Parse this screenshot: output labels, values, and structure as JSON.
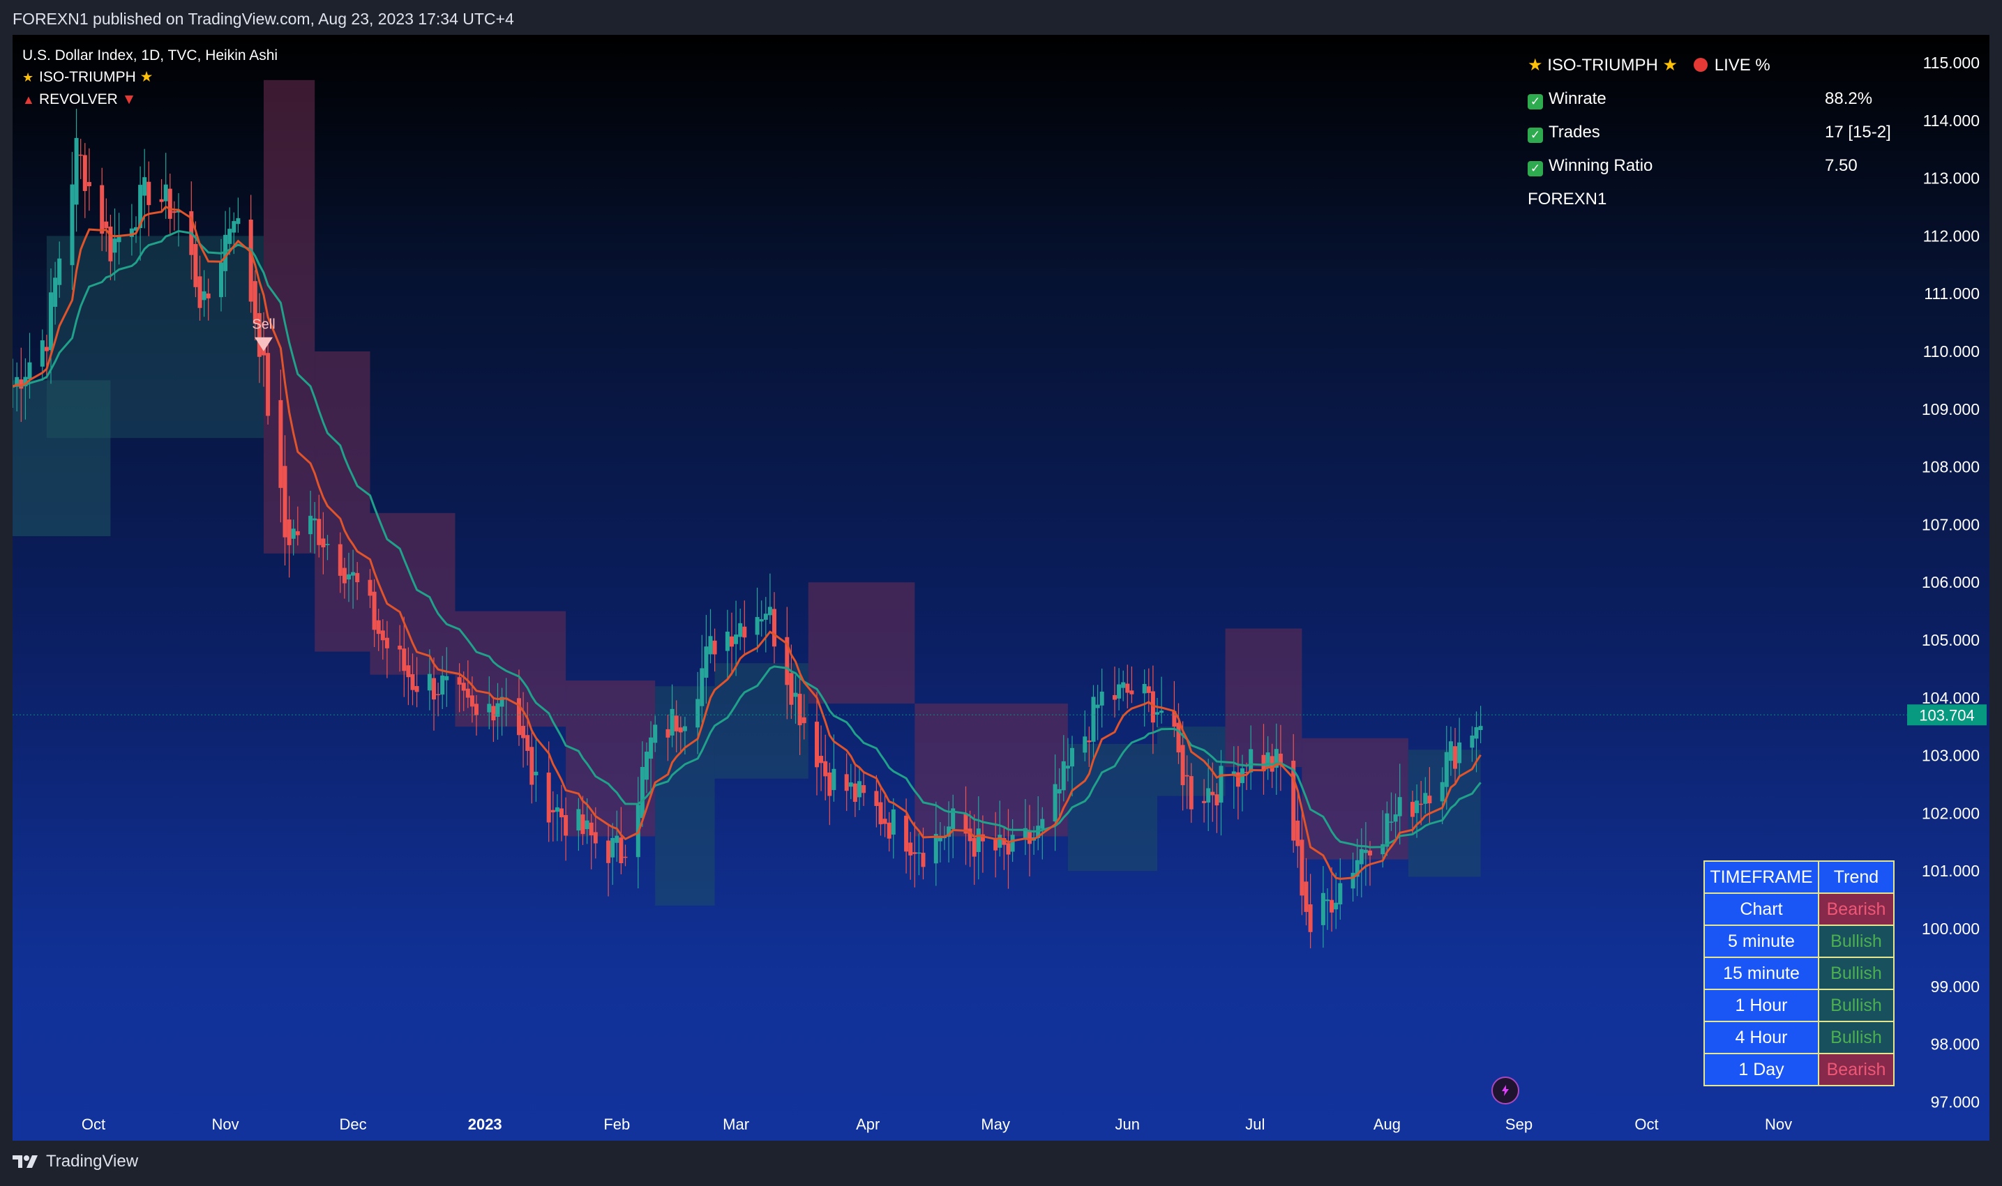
{
  "header": {
    "published": "FOREXN1 published on TradingView.com, Aug 23, 2023 17:34 UTC+4"
  },
  "legend": {
    "symbol": "U.S. Dollar Index, 1D, TVC, Heikin Ashi",
    "indicator1": "ISO-TRIUMPH",
    "indicator2": "REVOLVER"
  },
  "stats": {
    "title": "ISO-TRIUMPH",
    "live": "LIVE %",
    "rows": [
      {
        "label": "Winrate",
        "value": "88.2%"
      },
      {
        "label": "Trades",
        "value": "17 [15-2]"
      },
      {
        "label": "Winning Ratio",
        "value": "7.50"
      }
    ],
    "author": "FOREXN1"
  },
  "trend_table": {
    "header": [
      "TIMEFRAME",
      "Trend"
    ],
    "rows": [
      {
        "timeframe": "Chart",
        "trend": "Bearish"
      },
      {
        "timeframe": "5 minute",
        "trend": "Bullish"
      },
      {
        "timeframe": "15 minute",
        "trend": "Bullish"
      },
      {
        "timeframe": "1 Hour",
        "trend": "Bullish"
      },
      {
        "timeframe": "4 Hour",
        "trend": "Bullish"
      },
      {
        "timeframe": "1 Day",
        "trend": "Bearish"
      }
    ]
  },
  "colors": {
    "bull": "#26a69a",
    "bear": "#ef5350",
    "fast_ma": "#e0542b",
    "slow_ma": "#21a08a",
    "cloud_bear": "#6e2d52",
    "cloud_bull": "#1f5560",
    "price_label_bg": "#089981"
  },
  "footer": {
    "brand": "TradingView"
  },
  "chart_data": {
    "type": "candlestick",
    "title": "U.S. Dollar Index, 1D, TVC, Heikin Ashi",
    "y_axis": {
      "ticks": [
        "115.000",
        "114.000",
        "113.000",
        "112.000",
        "111.000",
        "110.000",
        "109.000",
        "108.000",
        "107.000",
        "106.000",
        "105.000",
        "104.000",
        "103.000",
        "102.000",
        "101.000",
        "100.000",
        "99.000",
        "98.000",
        "97.000"
      ],
      "range": [
        97.0,
        115.0
      ]
    },
    "x_axis": {
      "ticks": [
        "Oct",
        "Nov",
        "Dec",
        "2023",
        "Feb",
        "Mar",
        "Apr",
        "May",
        "Jun",
        "Jul",
        "Aug",
        "Sep",
        "Oct",
        "Nov"
      ]
    },
    "last_price": "103.704",
    "signal": {
      "label": "Sell",
      "date": "2022-11-10"
    },
    "close_path": [
      [
        "2022-09-12",
        109.4
      ],
      [
        "2022-09-20",
        110.3
      ],
      [
        "2022-09-27",
        113.5
      ],
      [
        "2022-10-05",
        111.8
      ],
      [
        "2022-10-14",
        112.8
      ],
      [
        "2022-10-21",
        112.4
      ],
      [
        "2022-10-27",
        110.7
      ],
      [
        "2022-11-03",
        112.5
      ],
      [
        "2022-11-09",
        110.2
      ],
      [
        "2022-11-15",
        106.8
      ],
      [
        "2022-11-22",
        107.0
      ],
      [
        "2022-11-30",
        106.2
      ],
      [
        "2022-12-08",
        105.0
      ],
      [
        "2022-12-15",
        104.3
      ],
      [
        "2022-12-22",
        104.2
      ],
      [
        "2022-12-30",
        103.6
      ],
      [
        "2023-01-06",
        104.2
      ],
      [
        "2023-01-13",
        102.4
      ],
      [
        "2023-01-20",
        101.9
      ],
      [
        "2023-01-27",
        101.5
      ],
      [
        "2023-02-02",
        101.3
      ],
      [
        "2023-02-09",
        103.2
      ],
      [
        "2023-02-17",
        103.8
      ],
      [
        "2023-02-24",
        105.0
      ],
      [
        "2023-03-08",
        105.6
      ],
      [
        "2023-03-15",
        104.0
      ],
      [
        "2023-03-22",
        102.7
      ],
      [
        "2023-03-31",
        102.2
      ],
      [
        "2023-04-07",
        101.8
      ],
      [
        "2023-04-14",
        101.4
      ],
      [
        "2023-04-21",
        101.8
      ],
      [
        "2023-04-28",
        101.4
      ],
      [
        "2023-05-05",
        101.3
      ],
      [
        "2023-05-12",
        101.7
      ],
      [
        "2023-05-19",
        102.9
      ],
      [
        "2023-05-26",
        104.0
      ],
      [
        "2023-06-02",
        104.1
      ],
      [
        "2023-06-09",
        103.8
      ],
      [
        "2023-06-16",
        102.3
      ],
      [
        "2023-06-23",
        102.5
      ],
      [
        "2023-06-30",
        103.0
      ],
      [
        "2023-07-07",
        102.8
      ],
      [
        "2023-07-14",
        100.0
      ],
      [
        "2023-07-21",
        100.8
      ],
      [
        "2023-07-28",
        101.6
      ],
      [
        "2023-08-04",
        102.0
      ],
      [
        "2023-08-11",
        102.5
      ],
      [
        "2023-08-18",
        103.2
      ],
      [
        "2023-08-23",
        103.7
      ]
    ]
  }
}
